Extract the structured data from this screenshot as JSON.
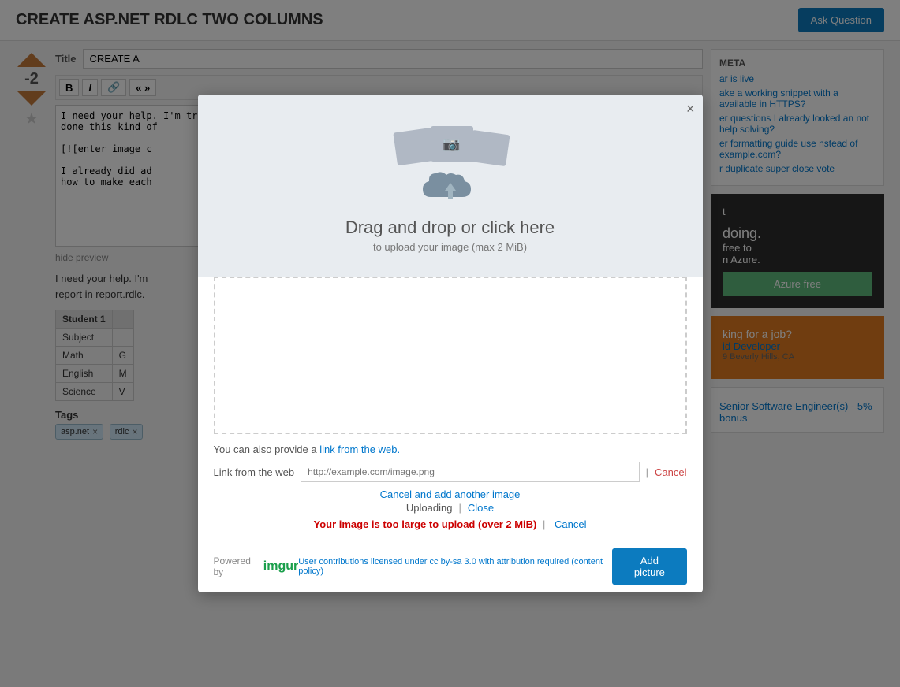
{
  "header": {
    "title": "CREATE ASP.NET RDLC TWO COLUMNS",
    "ask_question_label": "Ask Question"
  },
  "vote": {
    "count": "-2",
    "up_label": "▲",
    "down_label": "▼"
  },
  "editor": {
    "title_label": "Title",
    "title_value": "CREATE A",
    "toolbar_buttons": [
      "B",
      "I",
      "🔗",
      "« »"
    ],
    "content": "I need your help. I'm trying to create a\ndone this kind of\n\n[![enter image c\n\nI already did ad\nhow to make each",
    "hide_preview_label": "hide preview",
    "preview_line1": "I need your help. I'm",
    "preview_line2": "report in report.rdlc."
  },
  "table": {
    "headers": [
      "Student 1"
    ],
    "rows": [
      [
        "Subject",
        ""
      ],
      [
        "Math",
        "G"
      ],
      [
        "English",
        "M"
      ],
      [
        "Science",
        "V"
      ]
    ]
  },
  "tags": {
    "label": "Tags",
    "items": [
      "asp.net",
      "rdlc"
    ]
  },
  "sidebar": {
    "meta_title": "META",
    "meta_links": [
      "ar is live",
      "",
      "ake a working snippet with a\navailable in HTTPS?",
      "er questions I already looked\nan not help solving?",
      "er formatting guide use\nnstead of example.com?",
      "r duplicate super close vote"
    ],
    "ad1": {
      "line1": "t",
      "line2": "doing.",
      "line3": "free to",
      "line4": "n Azure."
    },
    "ad2": {
      "line1": "king for a job?"
    },
    "ad_free_label": "Azure free",
    "job1_title": "id Developer",
    "job1_location": "9  Beverly Hills, CA",
    "job2_title": "Senior Software Engineer(s) - 5% bonus"
  },
  "modal": {
    "close_label": "×",
    "upload_title": "Drag and drop or click here",
    "upload_subtitle": "to upload your image (max 2 MiB)",
    "link_text": "You can also provide a",
    "link_text_link": "link from the web.",
    "link_label": "Link from the web",
    "link_placeholder": "http://example.com/image.png",
    "cancel_label": "Cancel",
    "cancel_add_label": "Cancel and add another image",
    "uploading_label": "Uploading",
    "close_link_label": "Close",
    "error_text": "Your image is too large to upload (over 2 MiB)",
    "error_cancel_label": "Cancel",
    "powered_by": "Powered by",
    "imgur_logo": "imgur",
    "license_text": "User contributions licensed under cc by-sa 3.0 with attribution required (content policy)",
    "add_picture_label": "Add picture"
  }
}
